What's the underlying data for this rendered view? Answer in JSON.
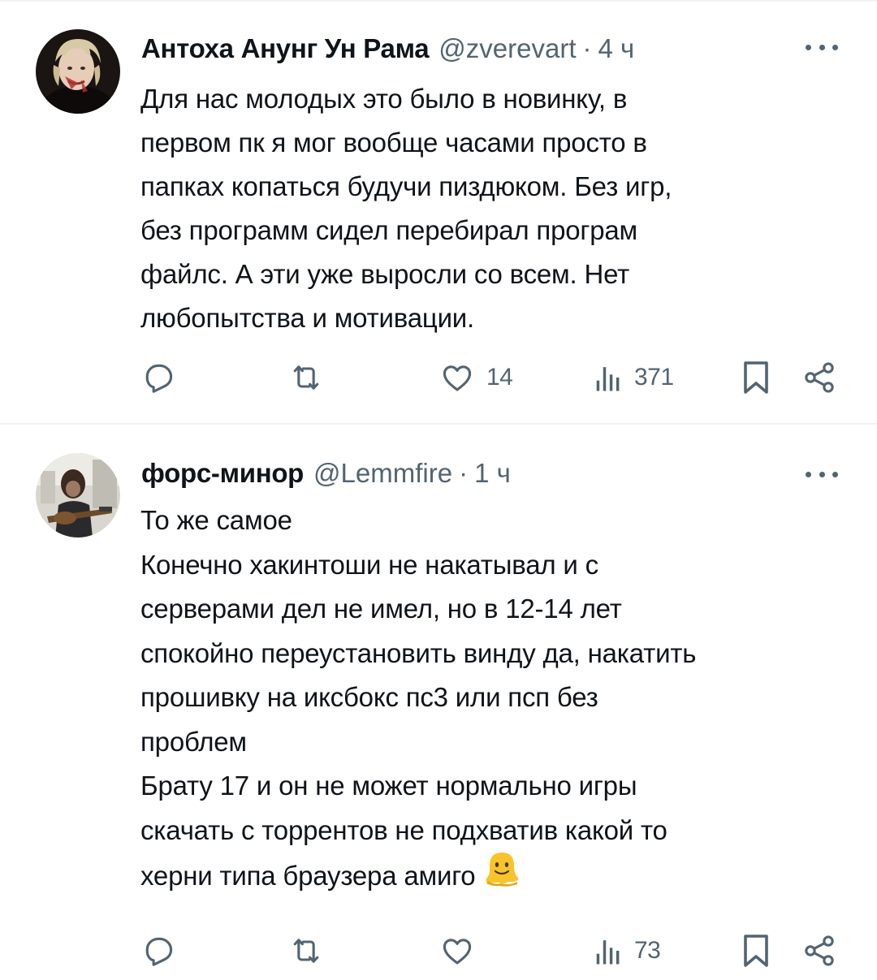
{
  "tweets": [
    {
      "author_name": "Антоха Анунг Ун Рама",
      "handle": "@zverevart",
      "separator": "·",
      "time": "4 ч",
      "text": "Для нас молодых это было в новинку, в\nпервом пк я мог вообще часами просто в\nпапках копаться будучи пиздюком. Без игр,\nбез программ сидел перебирал програм\nфайлс. А эти уже выросли со всем. Нет\nлюбопытства и мотивации.",
      "emoji": "",
      "reply_count": "",
      "retweet_count": "",
      "like_count": "14",
      "view_count": "371"
    },
    {
      "author_name": "форс-минор",
      "handle": "@Lemmfire",
      "separator": "·",
      "time": "1 ч",
      "text": "То же самое\nКонечно хакинтоши не накатывал и с\nсерверами дел не имел, но в 12-14 лет\nспокойно переустановить винду да, накатить\nпрошивку на иксбокс пс3 или псп без\nпроблем\nБрату 17 и он не может нормально игры\nскачать с торрентов не подхватив какой то\nхерни типа браузера амиго",
      "emoji": "melting-face-emoji",
      "reply_count": "",
      "retweet_count": "",
      "like_count": "",
      "view_count": "73"
    }
  ],
  "icons": {
    "reply": "reply-icon",
    "retweet": "retweet-icon",
    "like": "heart-icon",
    "views": "views-chart-icon",
    "bookmark": "bookmark-icon",
    "share": "share-icon",
    "more": "more-dots-icon"
  },
  "colors": {
    "text": "#0f1419",
    "secondary": "#536471",
    "divider": "#eff3f4",
    "background": "#ffffff",
    "emoji_yellow": "#f7c42b"
  }
}
